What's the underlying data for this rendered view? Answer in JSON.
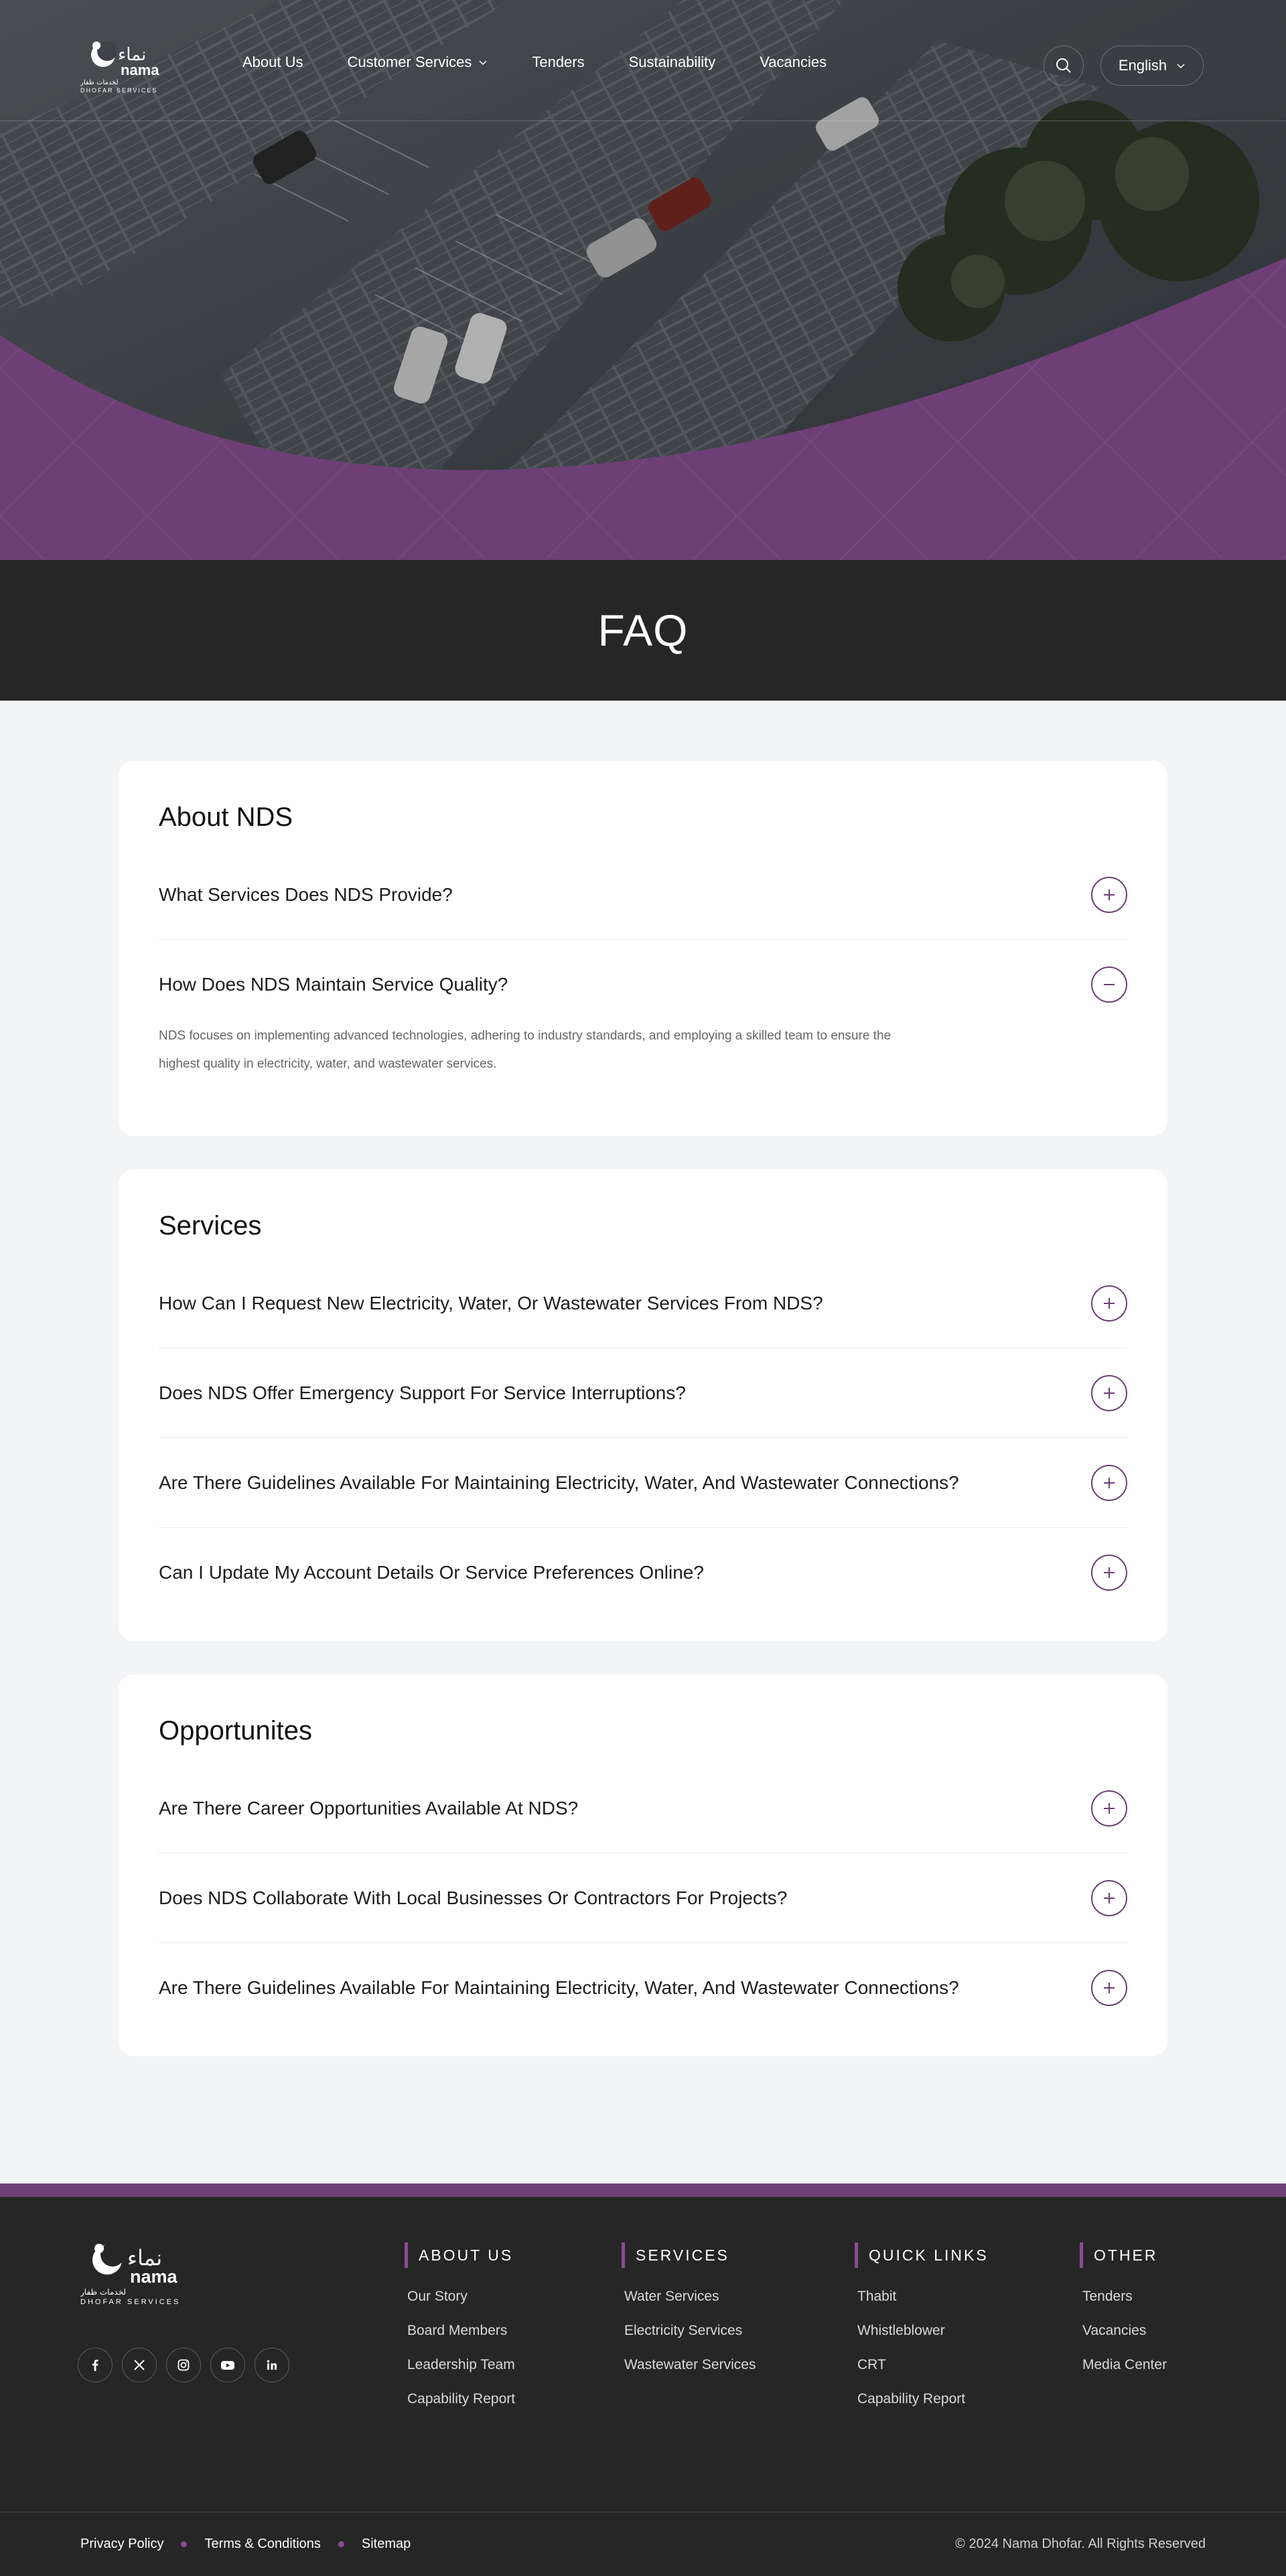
{
  "brand": {
    "logo_arabic": "نماء",
    "logo_latin": "nama",
    "logo_sub_arabic": "لخدمات ظفار",
    "logo_sub_latin": "DHOFAR SERVICES"
  },
  "nav": {
    "items": [
      "About Us",
      "Customer Services",
      "Tenders",
      "Sustainability",
      "Vacancies"
    ],
    "language": "English"
  },
  "page_title": "FAQ",
  "sections": [
    {
      "title": "About NDS",
      "questions": [
        {
          "q": "What Services Does NDS Provide?",
          "open": false
        },
        {
          "q": "How Does NDS Maintain Service Quality?",
          "open": true,
          "a": "NDS focuses on implementing advanced technologies, adhering to industry standards, and employing a skilled team to ensure the highest quality in electricity, water, and wastewater services."
        }
      ]
    },
    {
      "title": "Services",
      "questions": [
        {
          "q": "How Can I Request New Electricity, Water, Or Wastewater Services From NDS?",
          "open": false
        },
        {
          "q": "Does NDS Offer Emergency Support For Service Interruptions?",
          "open": false
        },
        {
          "q": "Are There Guidelines Available For Maintaining Electricity, Water, And Wastewater Connections?",
          "open": false
        },
        {
          "q": "Can I Update My Account Details Or Service Preferences Online?",
          "open": false
        }
      ]
    },
    {
      "title": "Opportunites",
      "questions": [
        {
          "q": "Are There Career Opportunities Available At NDS?",
          "open": false
        },
        {
          "q": "Does NDS Collaborate With Local Businesses Or Contractors For Projects?",
          "open": false
        },
        {
          "q": "Are There Guidelines Available For Maintaining Electricity, Water, And Wastewater Connections?",
          "open": false
        }
      ]
    }
  ],
  "footer": {
    "socials": [
      "facebook-icon",
      "x-icon",
      "instagram-icon",
      "youtube-icon",
      "linkedin-icon"
    ],
    "columns": {
      "about": {
        "title": "ABOUT US",
        "links": [
          "Our Story",
          "Board Members",
          "Leadership Team",
          "Capability Report"
        ]
      },
      "services": {
        "title": "SERVICES",
        "links": [
          "Water Services",
          "Electricity Services",
          "Wastewater Services"
        ]
      },
      "quick": {
        "title": "QUICK LINKS",
        "links": [
          "Thabit",
          "Whistleblower",
          "CRT",
          "Capability Report"
        ]
      },
      "other": {
        "title": "OTHER",
        "links": [
          "Tenders",
          "Vacancies",
          "Media Center"
        ]
      }
    },
    "legal": [
      "Privacy Policy",
      "Terms & Conditions",
      "Sitemap"
    ],
    "copyright": "© 2024 Nama Dhofar. All Rights Reserved"
  },
  "colors": {
    "brand_purple": "#6e3f77",
    "dark": "#262626",
    "background": "#f3f4f6"
  }
}
